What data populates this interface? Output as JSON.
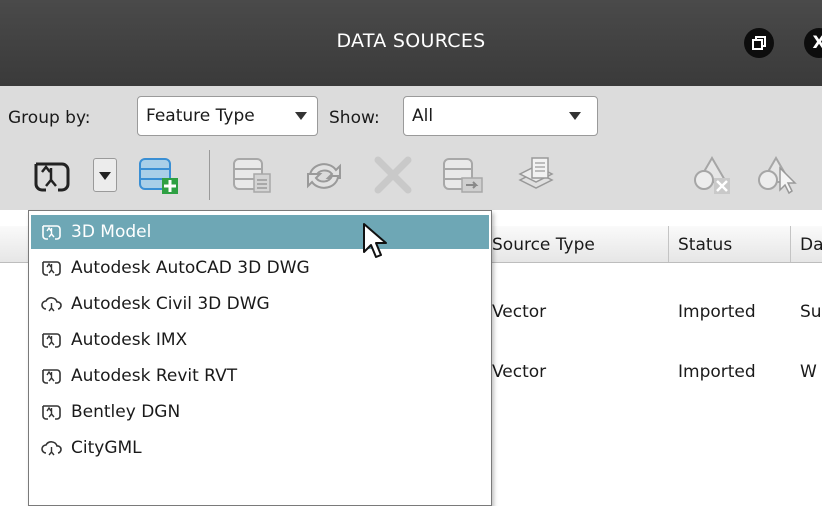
{
  "window": {
    "title": "DATA SOURCES",
    "restore_glyph": "ᵁ",
    "close_glyph": "X"
  },
  "controls": {
    "group_by_label": "Group by:",
    "group_by_value": "Feature Type",
    "show_label": "Show:",
    "show_value": "All"
  },
  "toolbar": {
    "icons": [
      "connect-data-icon",
      "dropdown-arrow-icon",
      "add-database-icon",
      "database-properties-icon",
      "refresh-icon",
      "remove-icon",
      "export-database-icon",
      "layer-style-icon",
      "delete-shape-icon",
      "select-shape-icon"
    ]
  },
  "table": {
    "columns": [
      "Source Type",
      "Status",
      "Da"
    ],
    "rows": [
      {
        "source_type": "Vector",
        "status": "Imported",
        "extra": "Su"
      },
      {
        "source_type": "Vector",
        "status": "Imported",
        "extra": "W"
      }
    ]
  },
  "dropdown": {
    "items": [
      {
        "label": "3D Model",
        "icon": "model-connector-icon",
        "selected": true
      },
      {
        "label": "Autodesk AutoCAD 3D DWG",
        "icon": "model-connector-icon",
        "selected": false
      },
      {
        "label": "Autodesk Civil 3D DWG",
        "icon": "cloud-connector-icon",
        "selected": false
      },
      {
        "label": "Autodesk IMX",
        "icon": "model-connector-icon",
        "selected": false
      },
      {
        "label": "Autodesk Revit RVT",
        "icon": "model-connector-icon",
        "selected": false
      },
      {
        "label": "Bentley DGN",
        "icon": "model-connector-icon",
        "selected": false
      },
      {
        "label": "CityGML",
        "icon": "cloud-connector-icon",
        "selected": false
      }
    ]
  },
  "colors": {
    "titlebar": "#3f3f3f",
    "selection": "#6ea7b5",
    "accent_green": "#2ea043",
    "accent_blue": "#3a8fd4"
  }
}
